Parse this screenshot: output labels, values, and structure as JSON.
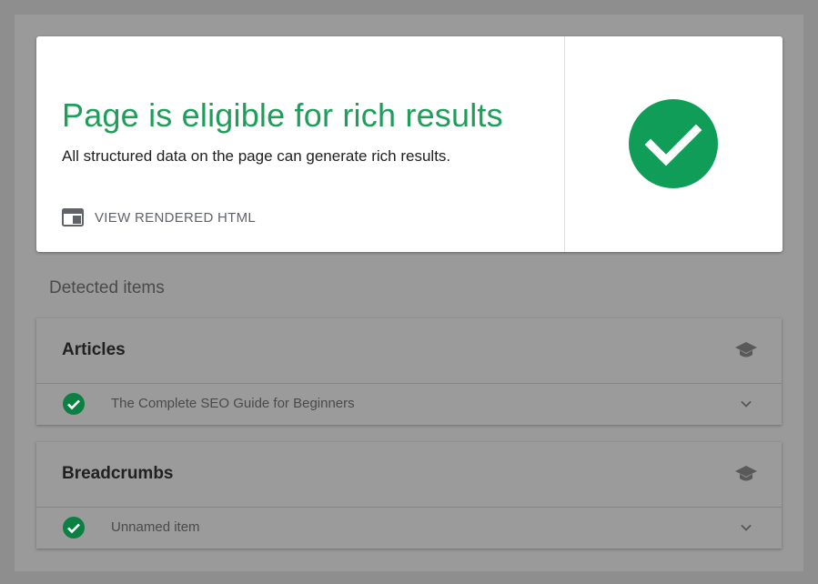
{
  "result": {
    "title": "Page is eligible for rich results",
    "subtitle": "All structured data on the page can generate rich results.",
    "view_html_label": "VIEW RENDERED HTML",
    "status_icon": "check-circle-icon",
    "status_color": "#0f9d58"
  },
  "detected": {
    "heading": "Detected items",
    "groups": [
      {
        "title": "Articles",
        "icon": "graduation-cap-icon",
        "items": [
          {
            "label": "The Complete SEO Guide for Beginners",
            "status_icon": "check-circle-icon",
            "status_color": "#0b8043"
          }
        ]
      },
      {
        "title": "Breadcrumbs",
        "icon": "graduation-cap-icon",
        "items": [
          {
            "label": "Unnamed item",
            "status_icon": "check-circle-icon",
            "status_color": "#0b8043"
          }
        ]
      }
    ]
  }
}
